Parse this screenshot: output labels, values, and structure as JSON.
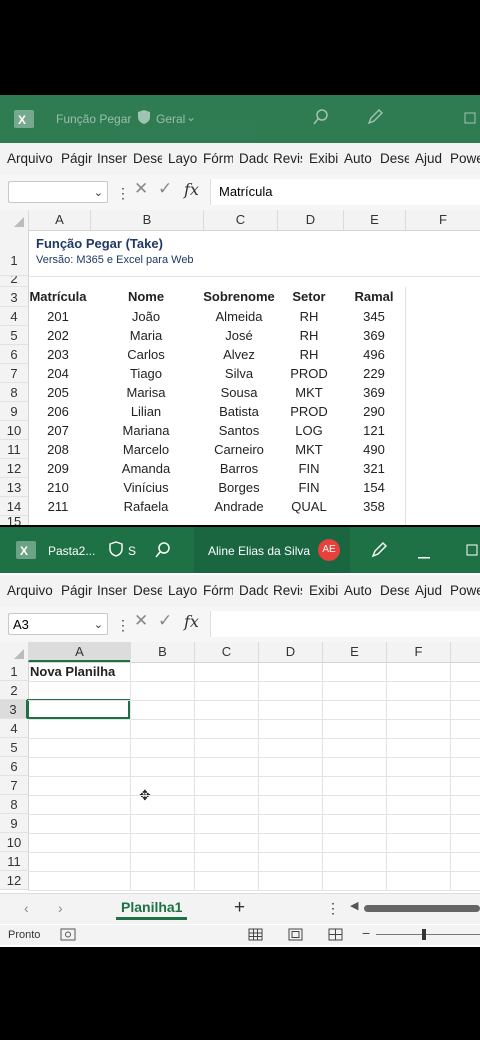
{
  "window1": {
    "title": "Função Pegar",
    "sensitivity": "Geral",
    "menu": [
      "Arquivo",
      "Págir",
      "Inser",
      "Dese",
      "Layo",
      "Fórm",
      "Dado",
      "Revis",
      "Exibi",
      "Auto",
      "Dese",
      "Ajud",
      "Powe"
    ],
    "namebox": "",
    "formula": "Matrícula",
    "columns": [
      "A",
      "B",
      "C",
      "D",
      "E",
      "F"
    ],
    "row_numbers": [
      "1",
      "2",
      "3",
      "4",
      "5",
      "6",
      "7",
      "8",
      "9",
      "10",
      "11",
      "12",
      "13",
      "14",
      "15"
    ],
    "heading_title": "Função Pegar (Take)",
    "heading_sub": "Versão: M365 e Excel para Web",
    "table_headers": [
      "Matrícula",
      "Nome",
      "Sobrenome",
      "Setor",
      "Ramal"
    ],
    "table_rows": [
      [
        "201",
        "João",
        "Almeida",
        "RH",
        "345"
      ],
      [
        "202",
        "Maria",
        "José",
        "RH",
        "369"
      ],
      [
        "203",
        "Carlos",
        "Alvez",
        "RH",
        "496"
      ],
      [
        "204",
        "Tiago",
        "Silva",
        "PROD",
        "229"
      ],
      [
        "205",
        "Marisa",
        "Sousa",
        "MKT",
        "369"
      ],
      [
        "206",
        "Lilian",
        "Batista",
        "PROD",
        "290"
      ],
      [
        "207",
        "Mariana",
        "Santos",
        "LOG",
        "121"
      ],
      [
        "208",
        "Marcelo",
        "Carneiro",
        "MKT",
        "490"
      ],
      [
        "209",
        "Amanda",
        "Barros",
        "FIN",
        "321"
      ],
      [
        "210",
        "Vinícius",
        "Borges",
        "FIN",
        "154"
      ],
      [
        "211",
        "Rafaela",
        "Andrade",
        "QUAL",
        "358"
      ]
    ]
  },
  "window2": {
    "title": "Pasta2...",
    "sensitivity": "S",
    "user": "Aline Elias da Silva",
    "avatar": "AE",
    "menu": [
      "Arquivo",
      "Págir",
      "Inser",
      "Dese",
      "Layo",
      "Fórm",
      "Dado",
      "Revis",
      "Exibi",
      "Auto",
      "Dese",
      "Ajud",
      "Powe"
    ],
    "namebox": "A3",
    "formula": "",
    "columns": [
      "A",
      "B",
      "C",
      "D",
      "E",
      "F"
    ],
    "row_numbers": [
      "1",
      "2",
      "3",
      "4",
      "5",
      "6",
      "7",
      "8",
      "9",
      "10",
      "11",
      "12"
    ],
    "a1": "Nova Planilha",
    "sheet_tab": "Planilha1",
    "status": "Pronto"
  },
  "icons": {
    "excel": "excel-logo-icon",
    "shield": "shield-icon",
    "search": "search-icon",
    "pen": "pen-icon",
    "minimize": "minimize-icon",
    "maximize": "maximize-icon"
  },
  "colors": {
    "excel_green": "#1e7145",
    "avatar_red": "#e8403a"
  }
}
